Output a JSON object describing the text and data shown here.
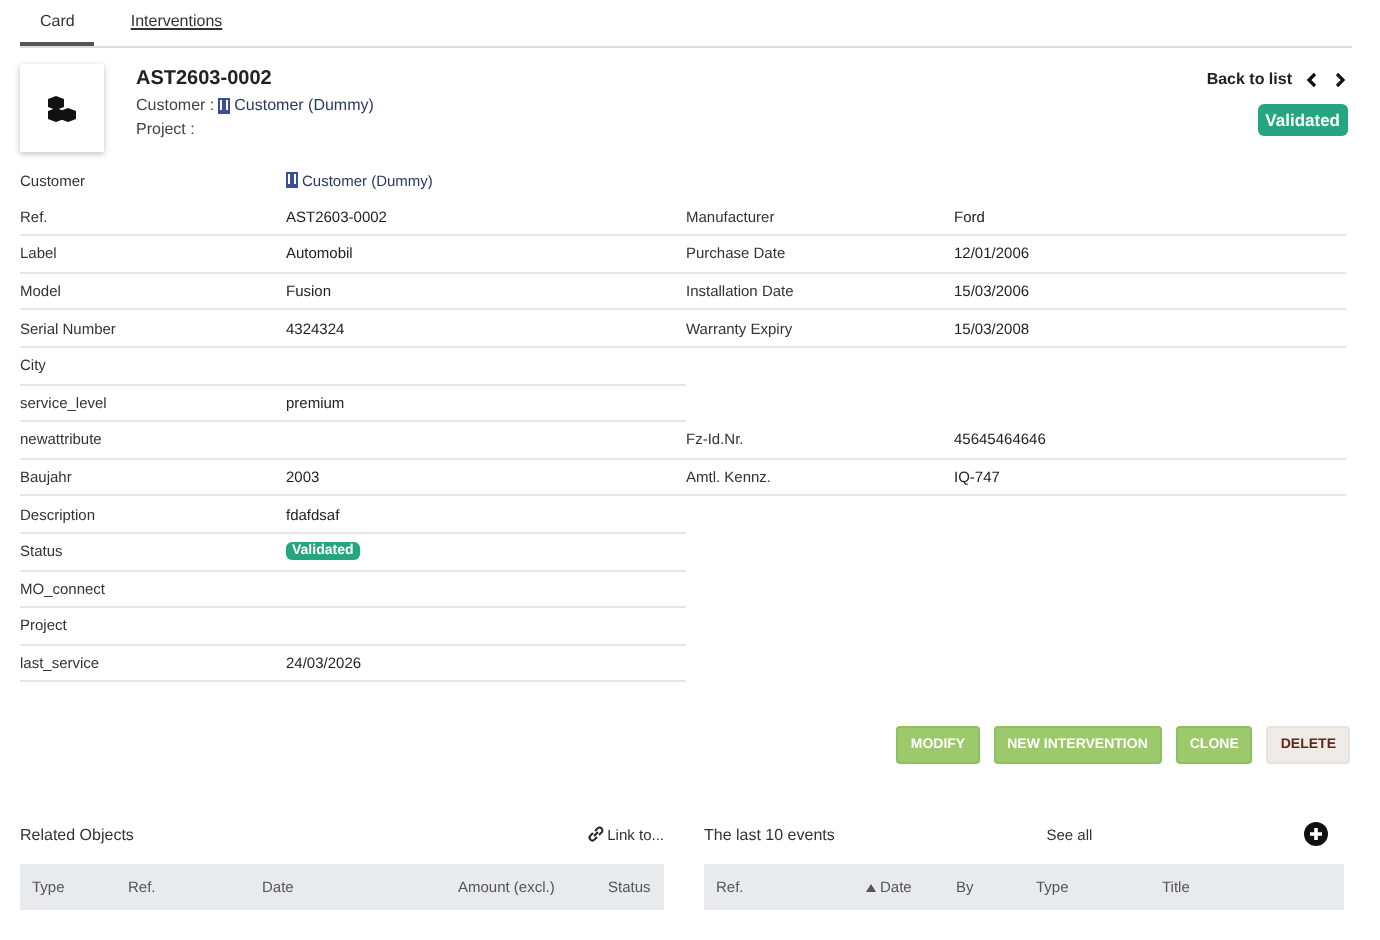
{
  "tabs": [
    {
      "label": "Card",
      "selected": true
    },
    {
      "label": "Interventions",
      "selected": false
    }
  ],
  "header": {
    "title": "AST2603-0002",
    "customer_label": "Customer :",
    "customer_value": "Customer (Dummy)",
    "project_label": "Project :",
    "back_link": "Back to list",
    "status_badge": "Validated"
  },
  "left_fields": [
    {
      "label": "Customer",
      "value": "Customer (Dummy)",
      "kind": "link"
    },
    {
      "label": "Ref.",
      "value": "AST2603-0002",
      "kind": "text"
    },
    {
      "label": "Label",
      "value": "Automobil",
      "kind": "text"
    },
    {
      "label": "Model",
      "value": "Fusion",
      "kind": "text"
    },
    {
      "label": "Serial Number",
      "value": "4324324",
      "kind": "text"
    },
    {
      "label": "City"
    },
    {
      "label": "service_level",
      "value": "premium",
      "kind": "text"
    },
    {
      "label": "newattribute"
    },
    {
      "label": "Baujahr",
      "value": "2003",
      "kind": "text"
    },
    {
      "label": "Description",
      "value": "fdafdsaf",
      "kind": "text"
    },
    {
      "label": "Status",
      "value": "Validated",
      "kind": "badge"
    },
    {
      "label": "MO_connect"
    },
    {
      "label": "Project"
    },
    {
      "label": "last_service",
      "value": "24/03/2026",
      "kind": "text"
    }
  ],
  "right_groups": [
    [
      {
        "label": "Manufacturer",
        "value": "Ford"
      },
      {
        "label": "Purchase Date",
        "value": "12/01/2006"
      },
      {
        "label": "Installation Date",
        "value": "15/03/2006"
      },
      {
        "label": "Warranty Expiry",
        "value": "15/03/2008"
      }
    ],
    [
      {
        "label": "Fz-Id.Nr.",
        "value": "45645464646"
      },
      {
        "label": "Amtl. Kennz.",
        "value": "IQ-747"
      }
    ]
  ],
  "actions": [
    {
      "label": "MODIFY",
      "kind": "primary"
    },
    {
      "label": "NEW INTERVENTION",
      "kind": "primary"
    },
    {
      "label": "CLONE",
      "kind": "primary"
    },
    {
      "label": "DELETE",
      "kind": "danger"
    }
  ],
  "related": {
    "title": "Related Objects",
    "link": "Link to...",
    "columns": [
      {
        "label": "Type"
      },
      {
        "label": "Ref."
      },
      {
        "label": "Date"
      },
      {
        "label": "Amount (excl.)"
      },
      {
        "label": "Status"
      }
    ]
  },
  "events": {
    "title": "The last 10 events",
    "see_all": "See all",
    "columns": [
      {
        "label": "Ref.",
        "sorted": false
      },
      {
        "label": "Date",
        "sorted": true
      },
      {
        "label": "By",
        "sorted": false
      },
      {
        "label": "Type",
        "sorted": false
      },
      {
        "label": "Title",
        "sorted": false
      }
    ]
  }
}
